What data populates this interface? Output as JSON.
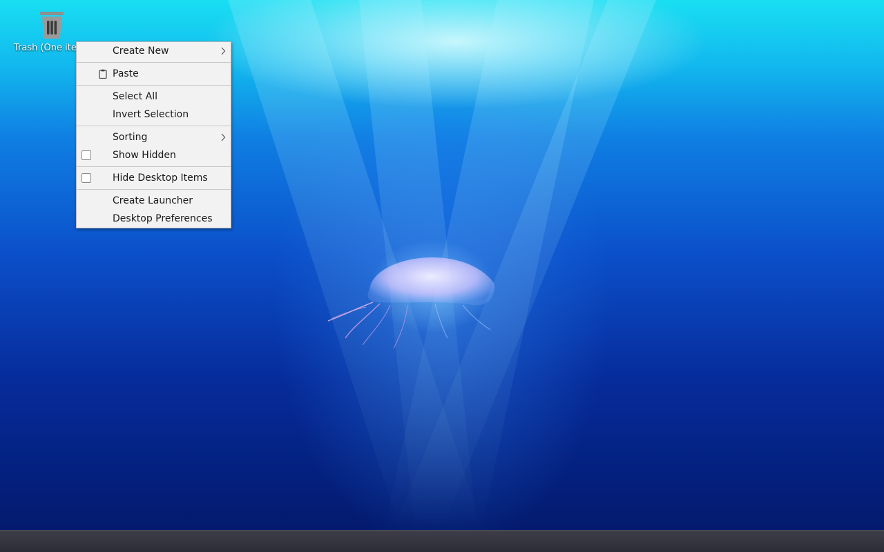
{
  "desktop": {
    "trash": {
      "label": "Trash (One ite",
      "icon": "trash-icon"
    }
  },
  "context_menu": {
    "create_new": {
      "label": "Create New",
      "has_submenu": true
    },
    "paste": {
      "label": "Paste",
      "icon": "clipboard-icon"
    },
    "select_all": {
      "label": "Select All"
    },
    "invert_selection": {
      "label": "Invert Selection"
    },
    "sorting": {
      "label": "Sorting",
      "has_submenu": true
    },
    "show_hidden": {
      "label": "Show Hidden",
      "checked": false
    },
    "hide_desktop_items": {
      "label": "Hide Desktop Items",
      "checked": false
    },
    "create_launcher": {
      "label": "Create Launcher"
    },
    "desktop_preferences": {
      "label": "Desktop Preferences"
    }
  },
  "colors": {
    "menu_background": "#f2f2f2",
    "menu_text": "#1a1a1a",
    "taskbar": "#2b2c36"
  }
}
